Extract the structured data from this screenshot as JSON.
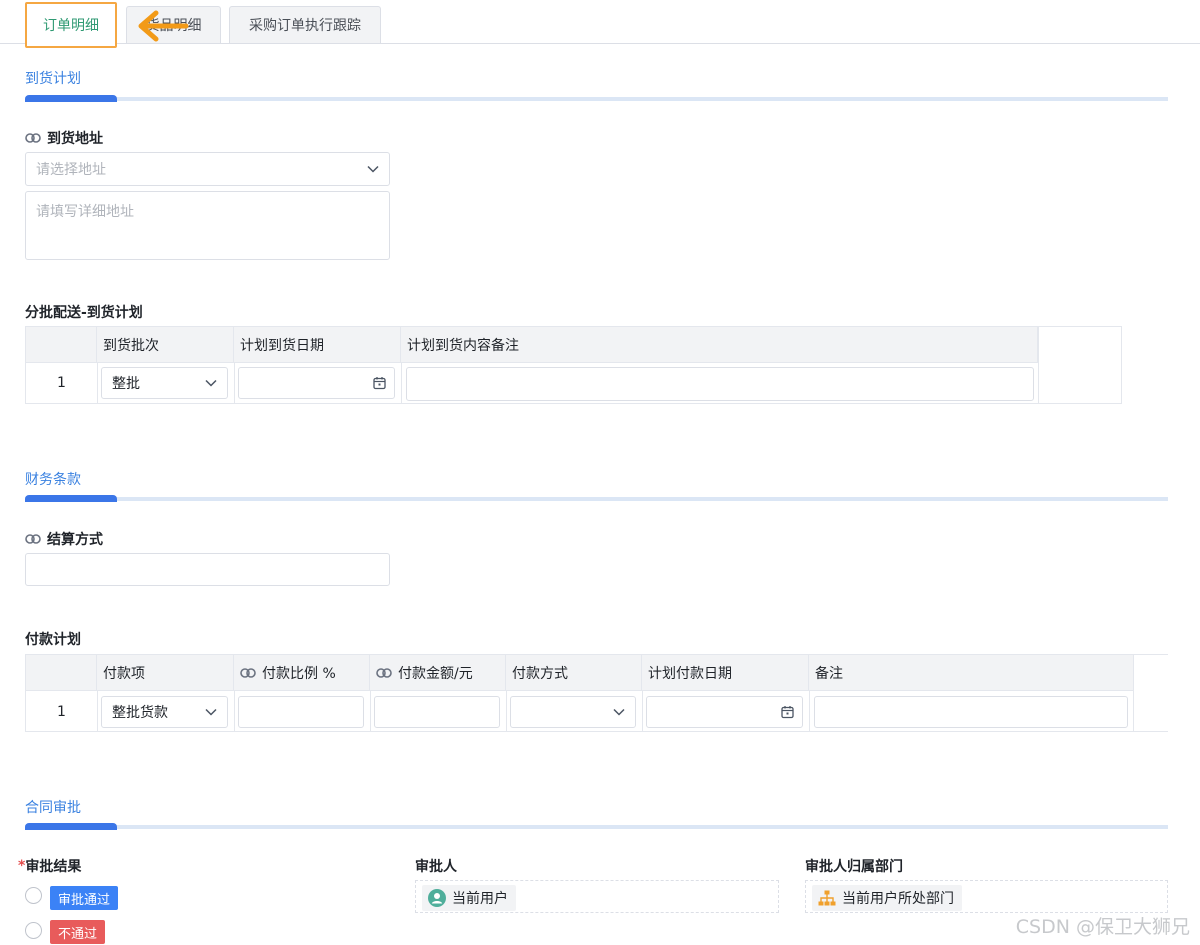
{
  "tabs": [
    {
      "label": "订单明细",
      "active": true
    },
    {
      "label": "货品明细",
      "active": false
    },
    {
      "label": "采购订单执行跟踪",
      "active": false
    }
  ],
  "arrival_plan": {
    "section_title": "到货计划",
    "address_label": "到货地址",
    "address_select_placeholder": "请选择地址",
    "address_detail_placeholder": "请填写详细地址",
    "batch_title": "分批配送-到货计划",
    "batch_table": {
      "columns": [
        "到货批次",
        "计划到货日期",
        "计划到货内容备注"
      ],
      "rows": [
        {
          "index": "1",
          "batch": "整批",
          "date": "",
          "note": ""
        }
      ]
    }
  },
  "finance": {
    "section_title": "财务条款",
    "settlement_label": "结算方式",
    "settlement_value": "",
    "payment_title": "付款计划",
    "payment_table": {
      "columns": [
        "付款项",
        "付款比例 %",
        "付款金额/元",
        "付款方式",
        "计划付款日期",
        "备注"
      ],
      "rows": [
        {
          "index": "1",
          "item": "整批货款",
          "ratio": "",
          "amount": "",
          "method": "",
          "date": "",
          "note": ""
        }
      ]
    }
  },
  "approval": {
    "section_title": "合同审批",
    "result_label": "审批结果",
    "required_mark": "*",
    "options": [
      {
        "label": "审批通过",
        "color": "#3b82f6"
      },
      {
        "label": "不通过",
        "color": "#e85b5b"
      }
    ],
    "approver_label": "审批人",
    "approver_value": "当前用户",
    "department_label": "审批人归属部门",
    "department_value": "当前用户所处部门"
  },
  "watermark": "CSDN @保卫大狮兄",
  "colors": {
    "accent_blue": "#3b76e8",
    "active_tab_border": "#f5a742",
    "active_tab_text": "#2f9a73",
    "arrow": "#f29a17"
  },
  "icons": {
    "link": "link-icon",
    "chevron": "chevron-down-icon",
    "calendar": "calendar-icon",
    "user": "user-icon",
    "org": "org-chart-icon",
    "arrow": "arrow-left-icon"
  }
}
